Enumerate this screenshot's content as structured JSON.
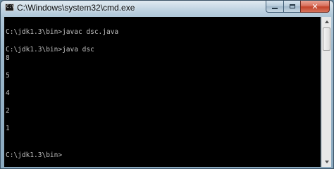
{
  "window": {
    "title": "C:\\Windows\\system32\\cmd.exe",
    "icon": "cmd-icon",
    "icon_prompt": "C:\\",
    "buttons": {
      "minimize_icon": "minimize-icon",
      "maximize_icon": "maximize-icon",
      "close_icon": "close-icon",
      "close_glyph": "✕"
    }
  },
  "console": {
    "background": "#000000",
    "foreground": "#c0c0c0",
    "lines": [
      "",
      "C:\\jdk1.3\\bin>javac dsc.java",
      "",
      "C:\\jdk1.3\\bin>java dsc",
      "8",
      "",
      "5",
      "",
      "4",
      "",
      "2",
      "",
      "1",
      "",
      "",
      "C:\\jdk1.3\\bin>"
    ]
  },
  "scrollbar": {
    "position": 0
  }
}
